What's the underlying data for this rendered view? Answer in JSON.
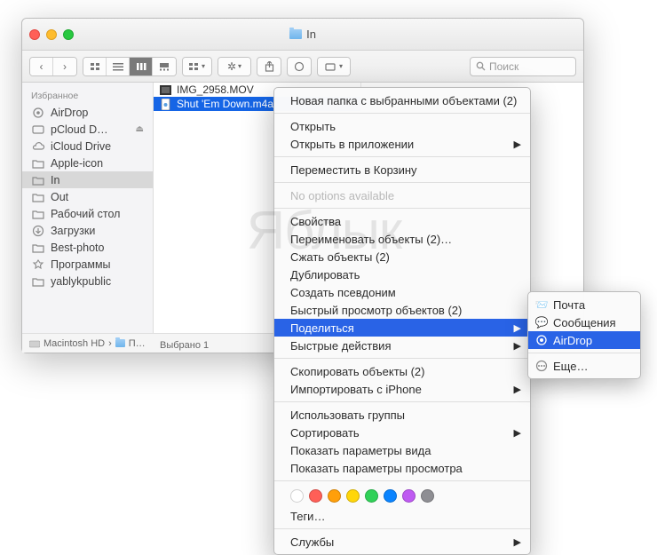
{
  "window": {
    "title": "In"
  },
  "search": {
    "placeholder": "Поиск"
  },
  "sidebar": {
    "header": "Избранное",
    "items": [
      {
        "label": "AirDrop",
        "icon": "airdrop"
      },
      {
        "label": "pCloud D…",
        "icon": "disk",
        "eject": true
      },
      {
        "label": "iCloud Drive",
        "icon": "cloud"
      },
      {
        "label": "Apple-icon",
        "icon": "folder"
      },
      {
        "label": "In",
        "icon": "folder",
        "selected": true
      },
      {
        "label": "Out",
        "icon": "folder"
      },
      {
        "label": "Рабочий стол",
        "icon": "folder"
      },
      {
        "label": "Загрузки",
        "icon": "downloads"
      },
      {
        "label": "Best-photo",
        "icon": "folder"
      },
      {
        "label": "Программы",
        "icon": "apps"
      },
      {
        "label": "yablykpublic",
        "icon": "folder"
      }
    ]
  },
  "files": [
    {
      "name": "IMG_2958.MOV",
      "icon": "mov"
    },
    {
      "name": "Shut 'Em Down.m4a",
      "icon": "audio",
      "selected": true
    }
  ],
  "pathbar": {
    "a": "Macintosh HD",
    "b": "П…"
  },
  "status": "Выбрано 1",
  "ctx": {
    "new_folder": "Новая папка с выбранными объектами (2)",
    "open": "Открыть",
    "open_with": "Открыть в приложении",
    "trash": "Переместить в Корзину",
    "noopts": "No options available",
    "info": "Свойства",
    "rename": "Переименовать объекты (2)…",
    "compress": "Сжать объекты (2)",
    "duplicate": "Дублировать",
    "alias": "Создать псевдоним",
    "quicklook": "Быстрый просмотр объектов (2)",
    "share": "Поделиться",
    "quick_actions": "Быстрые действия",
    "copy": "Скопировать объекты (2)",
    "import_iphone": "Импортировать с iPhone",
    "groups": "Использовать группы",
    "sort": "Сортировать",
    "view_opts": "Показать параметры вида",
    "preview_opts": "Показать параметры просмотра",
    "tags_label": "Теги…",
    "services": "Службы"
  },
  "tag_colors": [
    "#ffffff",
    "#ff5f57",
    "#ff9f0a",
    "#ffd60a",
    "#30d158",
    "#0a84ff",
    "#bf5af2",
    "#8e8e93"
  ],
  "submenu": {
    "mail": "Почта",
    "messages": "Сообщения",
    "airdrop": "AirDrop",
    "more": "Еще…"
  },
  "watermark": "Яблык"
}
